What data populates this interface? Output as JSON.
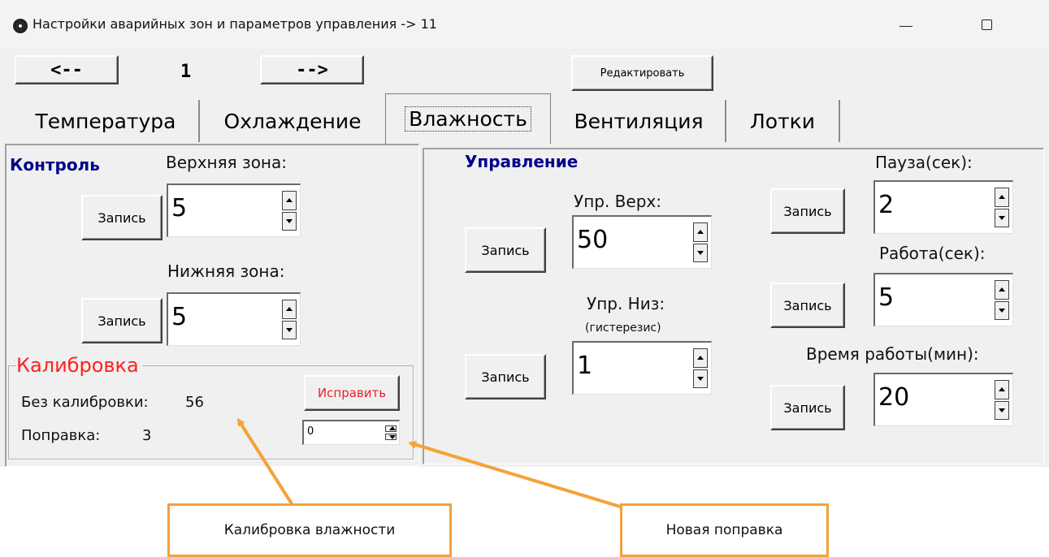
{
  "window": {
    "title": "Настройки аварийных зон и параметров управления -> 11"
  },
  "nav": {
    "prev_label": "<--",
    "page_number": "1",
    "next_label": "-->",
    "edit_label": "Редактировать"
  },
  "tabs": [
    {
      "label": "Температура"
    },
    {
      "label": "Охлаждение"
    },
    {
      "label": "Влажность"
    },
    {
      "label": "Вентиляция"
    },
    {
      "label": "Лотки"
    }
  ],
  "active_tab": "Влажность",
  "control": {
    "heading": "Контроль",
    "upper_label": "Верхняя зона:",
    "upper_value": "5",
    "lower_label": "Нижняя зона:",
    "lower_value": "5",
    "write_label": "Запись"
  },
  "calibration": {
    "heading": "Калибровка",
    "fix_label": "Исправить",
    "raw_label": "Без калибровки:",
    "raw_value": "56",
    "corr_label": "Поправка:",
    "corr_value": "3",
    "new_corr_value": "0"
  },
  "management": {
    "heading": "Управление",
    "up_label": "Упр. Верх:",
    "up_value": "50",
    "low_label": "Упр. Низ:",
    "low_sub": "(гистерезис)",
    "low_value": "1",
    "pause_label": "Пауза(сек):",
    "pause_value": "2",
    "work_label": "Работа(сек):",
    "work_value": "5",
    "worktime_label": "Время работы(мин):",
    "worktime_value": "20",
    "write_label": "Запись"
  },
  "annotations": {
    "calib_callout": "Калибровка влажности",
    "corr_callout": "Новая поправка"
  },
  "colors": {
    "heading_blue": "#00008b",
    "calib_red": "#ff2020",
    "callout_orange": "#f4a23a"
  }
}
